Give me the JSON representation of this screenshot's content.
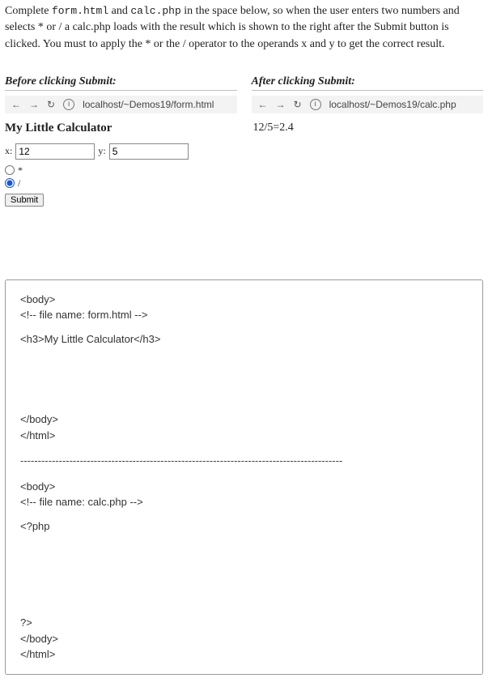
{
  "instructions": {
    "part1": "Complete ",
    "code1": "form.html",
    "part2": " and ",
    "code2": "calc.php",
    "part3": " in the space below, so when the user enters two numbers and selects * or / a calc.php loads with the result which is shown to the right after the Submit button is clicked. You must to apply the * or the / operator to the operands x and y to get the correct result."
  },
  "before": {
    "heading": "Before clicking Submit:",
    "url": "localhost/~Demos19/form.html",
    "title": "My Little Calculator",
    "x_label": "x:",
    "x_value": "12",
    "y_label": "y:",
    "y_value": "5",
    "op1": "*",
    "op2": "/",
    "submit": "Submit"
  },
  "after": {
    "heading": "After clicking Submit:",
    "url": "localhost/~Demos19/calc.php",
    "result": "12/5=2.4"
  },
  "answer": {
    "f_body_open": "<body>",
    "f_comment": "<!-- file name: form.html -->",
    "f_h3": "<h3>My Little Calculator</h3>",
    "f_body_close": "</body>",
    "f_html_close": "</html>",
    "c_body_open": "<body>",
    "c_comment": "<!-- file name: calc.php -->",
    "c_php_open": "<?php",
    "c_php_close": "?>",
    "c_body_close": "</body>",
    "c_html_close": "</html>"
  }
}
